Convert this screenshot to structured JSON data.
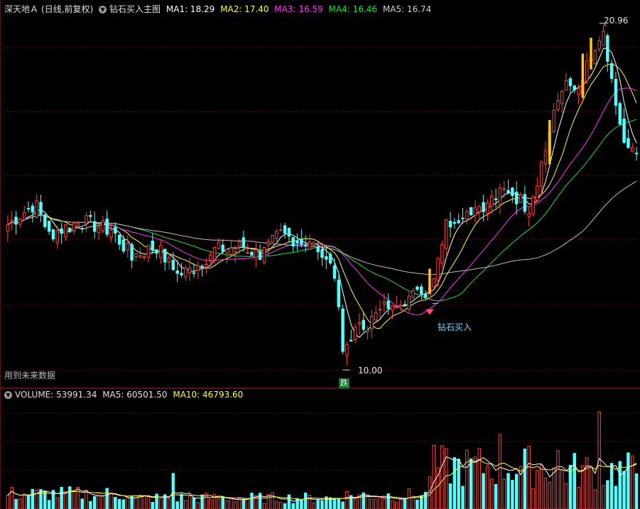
{
  "main_header": {
    "stock_name": "深天地Ａ",
    "period": "(日线,前复权)",
    "indicator_name": "钻石买入主图",
    "ma1_label": "MA1: 18.29",
    "ma2_label": "MA2: 17.40",
    "ma3_label": "MA3: 16.59",
    "ma4_label": "MA4: 16.46",
    "ma5_label": "MA5: 16.74"
  },
  "volume_header": {
    "volume_label": "VOLUME: 53991.34",
    "ma5_label": "MA5: 60501.50",
    "ma10_label": "MA10: 46793.60"
  },
  "annotations": {
    "high_price": "20.96",
    "low_price": "10.00",
    "buy_signal": "钻石买入",
    "fall_badge": "跌",
    "future_data_note": "用到未来数据"
  },
  "colors": {
    "up": "#ff4040",
    "down": "#54fcfc",
    "grid": "#8c1b1b",
    "signal": "#ffc61a",
    "ma1": "#ffffff",
    "ma2": "#ffff3a",
    "ma3": "#ff33ff",
    "ma4": "#22e03a",
    "ma5": "#bdbdbd"
  },
  "icons": {
    "panel_menu": "chevron-down-icon",
    "buy_marker": "diamond-icon"
  },
  "chart_data": {
    "type": "candlestick",
    "price_range": [
      9.8,
      21.2
    ],
    "ma_periods_visible": [
      "MA1",
      "MA2",
      "MA3",
      "MA4",
      "MA5"
    ],
    "anchors": [
      {
        "i": 0,
        "c": 14.6
      },
      {
        "i": 7,
        "c": 15.3
      },
      {
        "i": 10,
        "c": 14.3
      },
      {
        "i": 18,
        "c": 14.7
      },
      {
        "i": 25,
        "c": 14.4
      },
      {
        "i": 30,
        "c": 13.6
      },
      {
        "i": 36,
        "c": 13.9
      },
      {
        "i": 41,
        "c": 13.0
      },
      {
        "i": 45,
        "c": 13.2
      },
      {
        "i": 50,
        "c": 13.8
      },
      {
        "i": 57,
        "c": 13.9
      },
      {
        "i": 61,
        "c": 13.6
      },
      {
        "i": 66,
        "c": 14.3
      },
      {
        "i": 72,
        "c": 14.0
      },
      {
        "i": 76,
        "c": 13.8
      },
      {
        "i": 79,
        "c": 13.1
      },
      {
        "i": 81,
        "c": 10.4
      },
      {
        "i": 83,
        "c": 11.1
      },
      {
        "i": 88,
        "c": 11.6
      },
      {
        "i": 93,
        "c": 12.2
      },
      {
        "i": 100,
        "c": 12.4
      },
      {
        "i": 102,
        "c": 12.6
      },
      {
        "i": 106,
        "c": 14.6
      },
      {
        "i": 110,
        "c": 15.0
      },
      {
        "i": 116,
        "c": 15.3
      },
      {
        "i": 121,
        "c": 15.7
      },
      {
        "i": 126,
        "c": 15.1
      },
      {
        "i": 130,
        "c": 17.0
      },
      {
        "i": 134,
        "c": 19.0
      },
      {
        "i": 138,
        "c": 18.8
      },
      {
        "i": 141,
        "c": 19.9
      },
      {
        "i": 144,
        "c": 20.5
      },
      {
        "i": 147,
        "c": 18.2
      },
      {
        "i": 150,
        "c": 17.0
      },
      {
        "i": 152,
        "c": 16.9
      }
    ],
    "signals": [
      {
        "i": 102,
        "low": 12.4,
        "high": 13.2
      },
      {
        "i": 131,
        "low": 16.5,
        "high": 17.9
      },
      {
        "i": 139,
        "low": 18.6,
        "high": 20.0
      },
      {
        "i": 141,
        "low": 19.5,
        "high": 20.5
      }
    ],
    "buy_signal_index": 102,
    "high_index": 143,
    "low_index": 81,
    "volume_range": [
      0,
      170000
    ],
    "volume_profile": [
      {
        "from": 0,
        "to": 30,
        "base": 22000
      },
      {
        "from": 30,
        "to": 80,
        "base": 16000
      },
      {
        "from": 80,
        "to": 102,
        "base": 20000
      },
      {
        "from": 102,
        "to": 134,
        "base": 62000
      },
      {
        "from": 134,
        "to": 153,
        "base": 56000
      }
    ]
  }
}
